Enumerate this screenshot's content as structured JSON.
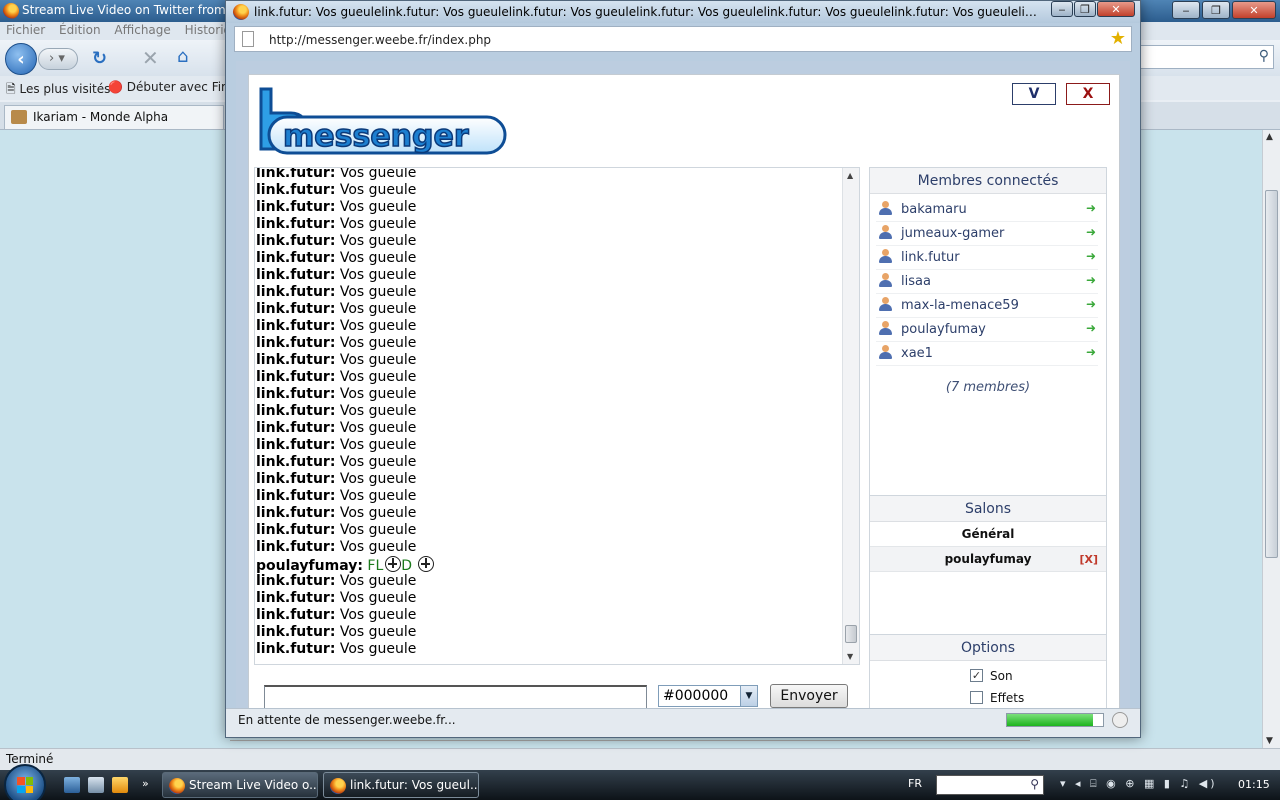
{
  "background_window": {
    "title": "Stream Live Video on Twitter from twi",
    "menu": [
      "Fichier",
      "Édition",
      "Affichage",
      "Historique"
    ],
    "bookmarks": [
      "Les plus visités",
      "Débuter avec Firef"
    ],
    "tab_label": "Ikariam - Monde Alpha",
    "status": "Terminé"
  },
  "popup": {
    "title": "link.futur: Vos gueulelink.futur: Vos gueulelink.futur: Vos gueulelink.futur: Vos gueulelink.futur: Vos gueulelink.futur: Vos gueulelink.futur: Vos gueule",
    "url": "http://messenger.weebe.fr/index.php",
    "status": "En attente de messenger.weebe.fr...",
    "progress": 0.9
  },
  "messenger": {
    "logo_text": "messenger",
    "header_buttons": {
      "v": "V",
      "x": "X"
    },
    "chat": [
      {
        "user": "link.futur:",
        "text": "Vos gueule"
      },
      {
        "user": "link.futur:",
        "text": "Vos gueule"
      },
      {
        "user": "link.futur:",
        "text": "Vos gueule"
      },
      {
        "user": "link.futur:",
        "text": "Vos gueule"
      },
      {
        "user": "link.futur:",
        "text": "Vos gueule"
      },
      {
        "user": "link.futur:",
        "text": "Vos gueule"
      },
      {
        "user": "link.futur:",
        "text": "Vos gueule"
      },
      {
        "user": "link.futur:",
        "text": "Vos gueule"
      },
      {
        "user": "link.futur:",
        "text": "Vos gueule"
      },
      {
        "user": "link.futur:",
        "text": "Vos gueule"
      },
      {
        "user": "link.futur:",
        "text": "Vos gueule"
      },
      {
        "user": "link.futur:",
        "text": "Vos gueule"
      },
      {
        "user": "link.futur:",
        "text": "Vos gueule"
      },
      {
        "user": "link.futur:",
        "text": "Vos gueule"
      },
      {
        "user": "link.futur:",
        "text": "Vos gueule"
      },
      {
        "user": "link.futur:",
        "text": "Vos gueule"
      },
      {
        "user": "link.futur:",
        "text": "Vos gueule"
      },
      {
        "user": "link.futur:",
        "text": "Vos gueule"
      },
      {
        "user": "link.futur:",
        "text": "Vos gueule"
      },
      {
        "user": "link.futur:",
        "text": "Vos gueule"
      },
      {
        "user": "link.futur:",
        "text": "Vos gueule"
      },
      {
        "user": "link.futur:",
        "text": "Vos gueule"
      },
      {
        "user": "link.futur:",
        "text": "Vos gueule"
      },
      {
        "user": "poulayfumay:",
        "text": "FL",
        "text2": "D",
        "green": true,
        "smileys": true
      },
      {
        "user": "link.futur:",
        "text": "Vos gueule"
      },
      {
        "user": "link.futur:",
        "text": "Vos gueule"
      },
      {
        "user": "link.futur:",
        "text": "Vos gueule"
      },
      {
        "user": "link.futur:",
        "text": "Vos gueule"
      },
      {
        "user": "link.futur:",
        "text": "Vos gueule"
      }
    ],
    "message_input_value": "",
    "color_value": "#000000",
    "send_label": "Envoyer",
    "members_title": "Membres connectés",
    "members": [
      "bakamaru",
      "jumeaux-gamer",
      "link.futur",
      "lisaa",
      "max-la-menace59",
      "poulayfumay",
      "xae1"
    ],
    "member_count": "(7 membres)",
    "salons_title": "Salons",
    "salons": [
      {
        "name": "Général",
        "closable": false
      },
      {
        "name": "poulayfumay",
        "closable": true,
        "close_label": "[X]"
      }
    ],
    "options_title": "Options",
    "options": [
      {
        "label": "Son",
        "checked": true
      },
      {
        "label": "Effets",
        "checked": false
      }
    ]
  },
  "taskbar": {
    "buttons": [
      "Stream Live Video o...",
      "link.futur: Vos gueul..."
    ],
    "lang": "FR",
    "clock": "01:15"
  },
  "colors": {
    "link_blue": "#2d3f6a",
    "flood_green": "#1c7a1c",
    "close_red": "#c0392b"
  }
}
